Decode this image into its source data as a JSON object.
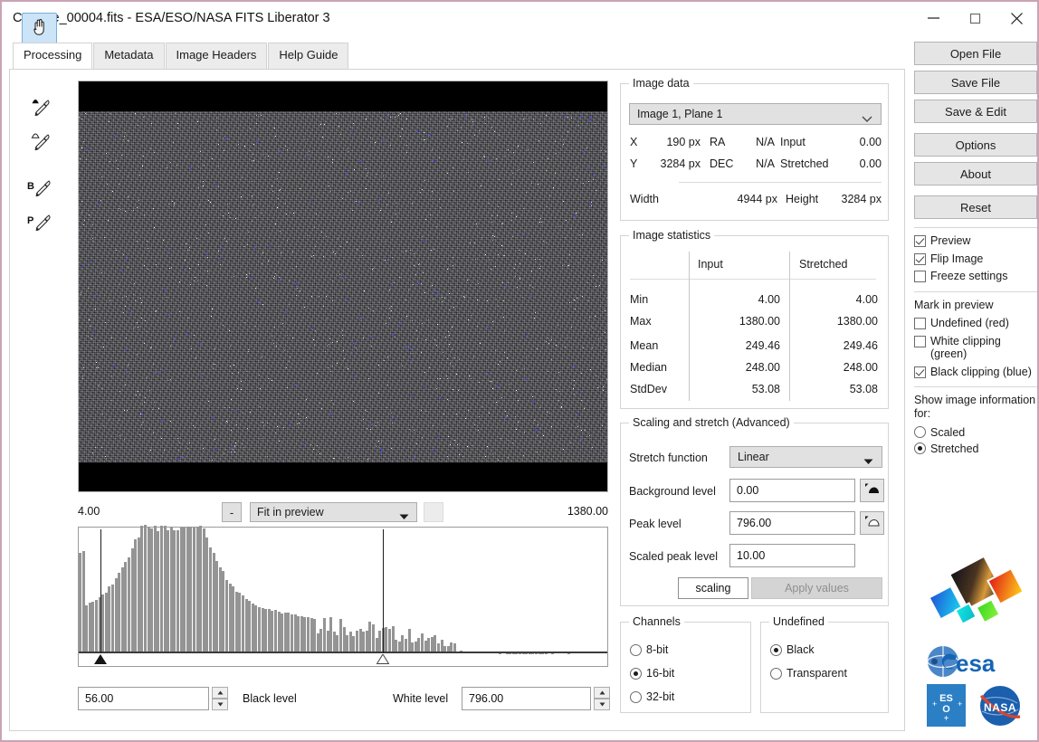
{
  "window": {
    "title": "Capture_00004.fits - ESA/ESO/NASA FITS Liberator 3",
    "minimize_label": "minimize-icon",
    "maximize_label": "maximize-icon",
    "close_label": "close-icon"
  },
  "tabs": [
    {
      "label": "Processing",
      "active": true
    },
    {
      "label": "Metadata",
      "active": false
    },
    {
      "label": "Image Headers",
      "active": false
    },
    {
      "label": "Help Guide",
      "active": false
    }
  ],
  "tools": [
    {
      "name": "hand-tool",
      "active": true
    },
    {
      "name": "zoom-tool",
      "active": false
    },
    {
      "name": "background-eyedropper-tool",
      "active": false
    },
    {
      "name": "peak-eyedropper-tool",
      "active": false
    },
    {
      "name": "black-level-eyedropper-tool",
      "active": false
    },
    {
      "name": "peak-level-eyedropper-tool",
      "active": false
    }
  ],
  "zoom_row": {
    "minus_label": "-",
    "zoom_mode": "Fit in preview"
  },
  "histogram": {
    "min_label": "4.00",
    "max_label": "1380.00",
    "black_marker_pct": 3.8,
    "white_marker_pct": 57.2
  },
  "levels": {
    "black_value": "56.00",
    "black_label": "Black level",
    "white_label": "White level",
    "white_value": "796.00"
  },
  "image_data": {
    "legend": "Image data",
    "plane_select": "Image 1, Plane 1",
    "x_label": "X",
    "x_value": "190 px",
    "ra_label": "RA",
    "ra_value": "N/A",
    "input_label": "Input",
    "input_value": "0.00",
    "y_label": "Y",
    "y_value": "3284 px",
    "dec_label": "DEC",
    "dec_value": "N/A",
    "stretched_label": "Stretched",
    "stretched_value": "0.00",
    "width_label": "Width",
    "width_value": "4944 px",
    "height_label": "Height",
    "height_value": "3284 px"
  },
  "image_statistics": {
    "legend": "Image statistics",
    "col_input": "Input",
    "col_stretched": "Stretched",
    "rows": [
      {
        "label": "Min",
        "input": "4.00",
        "stretched": "4.00"
      },
      {
        "label": "Max",
        "input": "1380.00",
        "stretched": "1380.00"
      },
      {
        "label": "Mean",
        "input": "249.46",
        "stretched": "249.46"
      },
      {
        "label": "Median",
        "input": "248.00",
        "stretched": "248.00"
      },
      {
        "label": "StdDev",
        "input": "53.08",
        "stretched": "53.08"
      }
    ]
  },
  "scaling": {
    "legend": "Scaling and stretch (Advanced)",
    "stretch_function_label": "Stretch function",
    "stretch_function_value": "Linear",
    "background_level_label": "Background level",
    "background_level_value": "0.00",
    "peak_level_label": "Peak level",
    "peak_level_value": "796.00",
    "scaled_peak_level_label": "Scaled peak level",
    "scaled_peak_level_value": "10.00",
    "scaling_button": "scaling",
    "apply_button": "Apply values"
  },
  "channels": {
    "legend": "Channels",
    "options": [
      {
        "label": "8-bit",
        "selected": false
      },
      {
        "label": "16-bit",
        "selected": true
      },
      {
        "label": "32-bit",
        "selected": false
      }
    ]
  },
  "undefined_group": {
    "legend": "Undefined",
    "options": [
      {
        "label": "Black",
        "selected": true
      },
      {
        "label": "Transparent",
        "selected": false
      }
    ]
  },
  "sidebar": {
    "buttons": [
      {
        "label": "Open File"
      },
      {
        "label": "Save File"
      },
      {
        "label": "Save & Edit"
      },
      {
        "label": "Options"
      },
      {
        "label": "About"
      },
      {
        "label": "Reset"
      }
    ],
    "checks": [
      {
        "label": "Preview",
        "checked": true
      },
      {
        "label": "Flip Image",
        "checked": true
      },
      {
        "label": "Freeze settings",
        "checked": false
      }
    ],
    "mark_heading": "Mark in preview",
    "mark_checks": [
      {
        "label": "Undefined (red)",
        "checked": false
      },
      {
        "label": "White clipping (green)",
        "checked": false
      },
      {
        "label": "Black clipping (blue)",
        "checked": true
      }
    ],
    "show_heading": "Show image information for:",
    "show_options": [
      {
        "label": "Scaled",
        "selected": false
      },
      {
        "label": "Stretched",
        "selected": true
      }
    ]
  },
  "colors": {
    "window_border": "#c9a3b4",
    "accent_selected_tool": "#cce4f7",
    "esa_blue": "#2b74c0",
    "nasa_blue": "#1b5fae",
    "nasa_red": "#d8462e"
  }
}
